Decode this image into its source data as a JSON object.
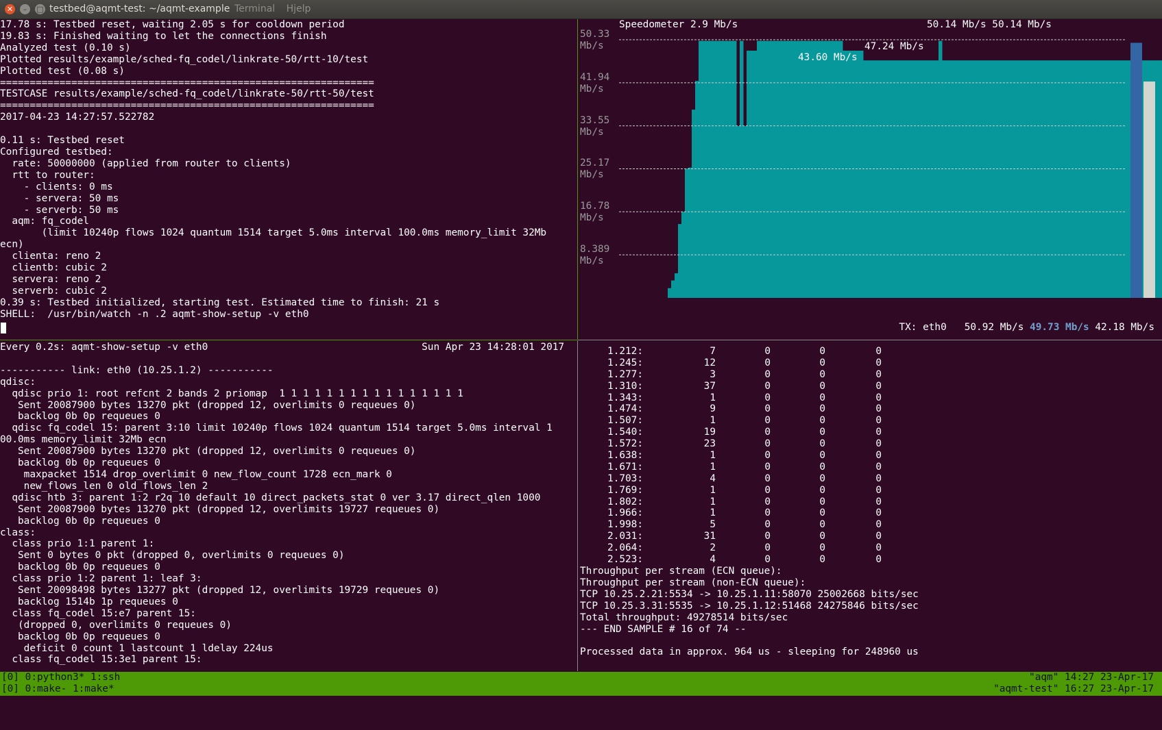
{
  "window": {
    "title": "testbed@aqmt-test: ~/aqmt-example",
    "menu": [
      "Terminal",
      "Hjelp"
    ]
  },
  "pane_top_left": {
    "lines": [
      "17.78 s: Testbed reset, waiting 2.05 s for cooldown period",
      "19.83 s: Finished waiting to let the connections finish",
      "Analyzed test (0.10 s)",
      "Plotted results/example/sched-fq_codel/linkrate-50/rtt-10/test",
      "Plotted test (0.08 s)",
      "===============================================================",
      "TESTCASE results/example/sched-fq_codel/linkrate-50/rtt-50/test",
      "===============================================================",
      "2017-04-23 14:27:57.522782",
      "",
      "0.11 s: Testbed reset",
      "Configured testbed:",
      "  rate: 50000000 (applied from router to clients)",
      "  rtt to router:",
      "    - clients: 0 ms",
      "    - servera: 50 ms",
      "    - serverb: 50 ms",
      "  aqm: fq_codel",
      "       (limit 10240p flows 1024 quantum 1514 target 5.0ms interval 100.0ms memory_limit 32Mb",
      "ecn)",
      "  clienta: reno 2",
      "  clientb: cubic 2",
      "  servera: reno 2",
      "  serverb: cubic 2",
      "0.39 s: Testbed initialized, starting test. Estimated time to finish: 21 s",
      "SHELL:  /usr/bin/watch -n .2 aqmt-show-setup -v eth0"
    ]
  },
  "pane_bottom_left": {
    "lines": [
      "Every 0.2s: aqmt-show-setup -v eth0                                    Sun Apr 23 14:28:01 2017",
      "",
      "----------- link: eth0 (10.25.1.2) -----------",
      "qdisc:",
      "  qdisc prio 1: root refcnt 2 bands 2 priomap  1 1 1 1 1 1 1 1 1 1 1 1 1 1 1 1",
      "   Sent 20087900 bytes 13270 pkt (dropped 12, overlimits 0 requeues 0)",
      "   backlog 0b 0p requeues 0",
      "  qdisc fq_codel 15: parent 3:10 limit 10240p flows 1024 quantum 1514 target 5.0ms interval 1",
      "00.0ms memory_limit 32Mb ecn",
      "   Sent 20087900 bytes 13270 pkt (dropped 12, overlimits 0 requeues 0)",
      "   backlog 0b 0p requeues 0",
      "    maxpacket 1514 drop_overlimit 0 new_flow_count 1728 ecn_mark 0",
      "    new_flows_len 0 old_flows_len 2",
      "  qdisc htb 3: parent 1:2 r2q 10 default 10 direct_packets_stat 0 ver 3.17 direct_qlen 1000",
      "   Sent 20087900 bytes 13270 pkt (dropped 12, overlimits 19727 requeues 0)",
      "   backlog 0b 0p requeues 0",
      "class:",
      "  class prio 1:1 parent 1:",
      "   Sent 0 bytes 0 pkt (dropped 0, overlimits 0 requeues 0)",
      "   backlog 0b 0p requeues 0",
      "  class prio 1:2 parent 1: leaf 3:",
      "   Sent 20098498 bytes 13277 pkt (dropped 12, overlimits 19729 requeues 0)",
      "   backlog 1514b 1p requeues 0",
      "  class fq_codel 15:e7 parent 15:",
      "   (dropped 0, overlimits 0 requeues 0)",
      "   backlog 0b 0p requeues 0",
      "    deficit 0 count 1 lastcount 1 ldelay 224us",
      "  class fq_codel 15:3e1 parent 15:"
    ]
  },
  "speedometer": {
    "title": "Speedometer 2.9 Mb/s",
    "peak_label": "50.14 Mb/s 50.14 Mb/s",
    "annotation_1": "47.24 Mb/s",
    "annotation_2": "43.60 Mb/s",
    "y_ticks": [
      "50.33",
      "41.94",
      "33.55",
      "25.17",
      "16.78",
      "8.389"
    ],
    "y_unit": "Mb/s",
    "y_max": 50.33,
    "samples_mbps": [
      1.9,
      3.4,
      4.8,
      14.4,
      16.8,
      25.2,
      25.4,
      36.7,
      42.3,
      50.1,
      50.1,
      50.1,
      50.1,
      50.1,
      50.1,
      50.1,
      50.1,
      50.1,
      50.1,
      50.1,
      33.5,
      50.1,
      33.5,
      48.2,
      48.2,
      48.2,
      50.1,
      50.1,
      50.1,
      50.1,
      50.1,
      50.1,
      50.1,
      50.1,
      50.1,
      50.1,
      50.1,
      50.1,
      50.1,
      50.1,
      50.1,
      50.1,
      50.1,
      50.1,
      50.1,
      50.1,
      50.1,
      50.1,
      50.1,
      50.1,
      50.1,
      48.2,
      48.2,
      48.2,
      48.2,
      48.2,
      48.2,
      46.3,
      46.3,
      46.3,
      46.3,
      46.3,
      46.3,
      46.3,
      46.3,
      46.3,
      46.3,
      46.3,
      46.3,
      46.3,
      46.3,
      46.3,
      46.3,
      46.3,
      46.3,
      46.3,
      46.3,
      46.3,
      46.3,
      50.1,
      46.3,
      46.3,
      46.3,
      46.3,
      46.3,
      46.3,
      46.3,
      46.3,
      46.3,
      46.3,
      46.3,
      46.3,
      46.3,
      46.3,
      46.3,
      46.3,
      46.3,
      46.3,
      46.3,
      46.3,
      46.3,
      46.3,
      46.3,
      46.3,
      46.3,
      46.3,
      46.3,
      46.3,
      46.3,
      46.3,
      46.3,
      46.3,
      46.3,
      46.3,
      46.3,
      46.3,
      46.3,
      46.3,
      46.3,
      46.3,
      46.3,
      46.3,
      46.3,
      46.3,
      46.3,
      46.3,
      46.3,
      46.3,
      46.3,
      46.3,
      46.3,
      46.3,
      46.3,
      46.3,
      46.3,
      46.3,
      46.3,
      46.3,
      46.3,
      46.3,
      46.3,
      46.3,
      46.3,
      46.3,
      46.3,
      46.3,
      46.3,
      46.3,
      46.3
    ],
    "tx_iface": "TX: eth0",
    "tx_current": "50.92 Mb/s",
    "tx_avg": "49.73 Mb/s",
    "tx_other": "42.18 Mb/s",
    "bar_avg_mbps": 49.73,
    "bar_other_mbps": 42.18,
    "colors": {
      "fill": "#06989a",
      "avg_bar": "#3465a4",
      "other_bar": "#d3d7cf",
      "grid": "#cccccc",
      "background": "#300a24"
    }
  },
  "pane_bottom_right": {
    "rows": [
      [
        "1.212:",
        "7",
        "0",
        "0",
        "0"
      ],
      [
        "1.245:",
        "12",
        "0",
        "0",
        "0"
      ],
      [
        "1.277:",
        "3",
        "0",
        "0",
        "0"
      ],
      [
        "1.310:",
        "37",
        "0",
        "0",
        "0"
      ],
      [
        "1.343:",
        "1",
        "0",
        "0",
        "0"
      ],
      [
        "1.474:",
        "9",
        "0",
        "0",
        "0"
      ],
      [
        "1.507:",
        "1",
        "0",
        "0",
        "0"
      ],
      [
        "1.540:",
        "19",
        "0",
        "0",
        "0"
      ],
      [
        "1.572:",
        "23",
        "0",
        "0",
        "0"
      ],
      [
        "1.638:",
        "1",
        "0",
        "0",
        "0"
      ],
      [
        "1.671:",
        "1",
        "0",
        "0",
        "0"
      ],
      [
        "1.703:",
        "4",
        "0",
        "0",
        "0"
      ],
      [
        "1.769:",
        "1",
        "0",
        "0",
        "0"
      ],
      [
        "1.802:",
        "1",
        "0",
        "0",
        "0"
      ],
      [
        "1.966:",
        "1",
        "0",
        "0",
        "0"
      ],
      [
        "1.998:",
        "5",
        "0",
        "0",
        "0"
      ],
      [
        "2.031:",
        "31",
        "0",
        "0",
        "0"
      ],
      [
        "2.064:",
        "2",
        "0",
        "0",
        "0"
      ],
      [
        "2.523:",
        "4",
        "0",
        "0",
        "0"
      ]
    ],
    "footer_lines": [
      "Throughput per stream (ECN queue):",
      "Throughput per stream (non-ECN queue):",
      "TCP 10.25.2.21:5534 -> 10.25.1.11:58070 25002668 bits/sec",
      "TCP 10.25.3.31:5535 -> 10.25.1.12:51468 24275846 bits/sec",
      "Total throughput: 49278514 bits/sec",
      "--- END SAMPLE # 16 of 74 --",
      "",
      "Processed data in approx. 964 us - sleeping for 248960 us"
    ]
  },
  "tmux": {
    "line1_left": "[0] 0:python3* 1:ssh",
    "line1_right": "\"aqm\" 14:27 23-Apr-17",
    "line2_left": "[0] 0:make- 1:make*",
    "line2_right": "\"aqmt-test\" 16:27 23-Apr-17"
  }
}
